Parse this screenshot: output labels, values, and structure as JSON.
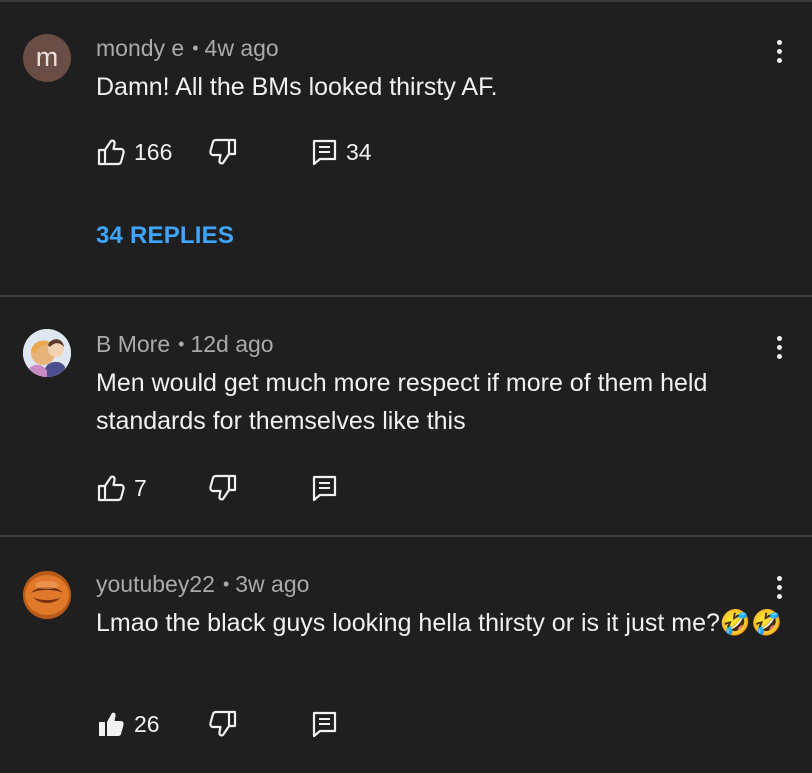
{
  "comments": [
    {
      "author": "mondy e",
      "separator": "•",
      "time": "4w ago",
      "avatar_letter": "m",
      "text": "Damn! All the BMs looked thirsty AF.",
      "likes": "166",
      "replies_count": "34",
      "replies_link": "34 REPLIES",
      "liked": false
    },
    {
      "author": "B More",
      "separator": "•",
      "time": "12d ago",
      "avatar_icon": "anime-character-avatar",
      "text": "Men would get much more respect if more of them held standards for themselves like this",
      "likes": "7",
      "liked": false
    },
    {
      "author": "youtubey22",
      "separator": "•",
      "time": "3w ago",
      "avatar_icon": "laughing-face-avatar",
      "text": "Lmao the black guys looking hella thirsty or is it just me?🤣🤣",
      "likes": "26",
      "liked": true
    }
  ],
  "colors": {
    "background": "#1f1f1f",
    "divider": "#3b3b3b",
    "link": "#3ea6ff",
    "meta": "#aaaaaa",
    "text": "#f1f1f1"
  }
}
